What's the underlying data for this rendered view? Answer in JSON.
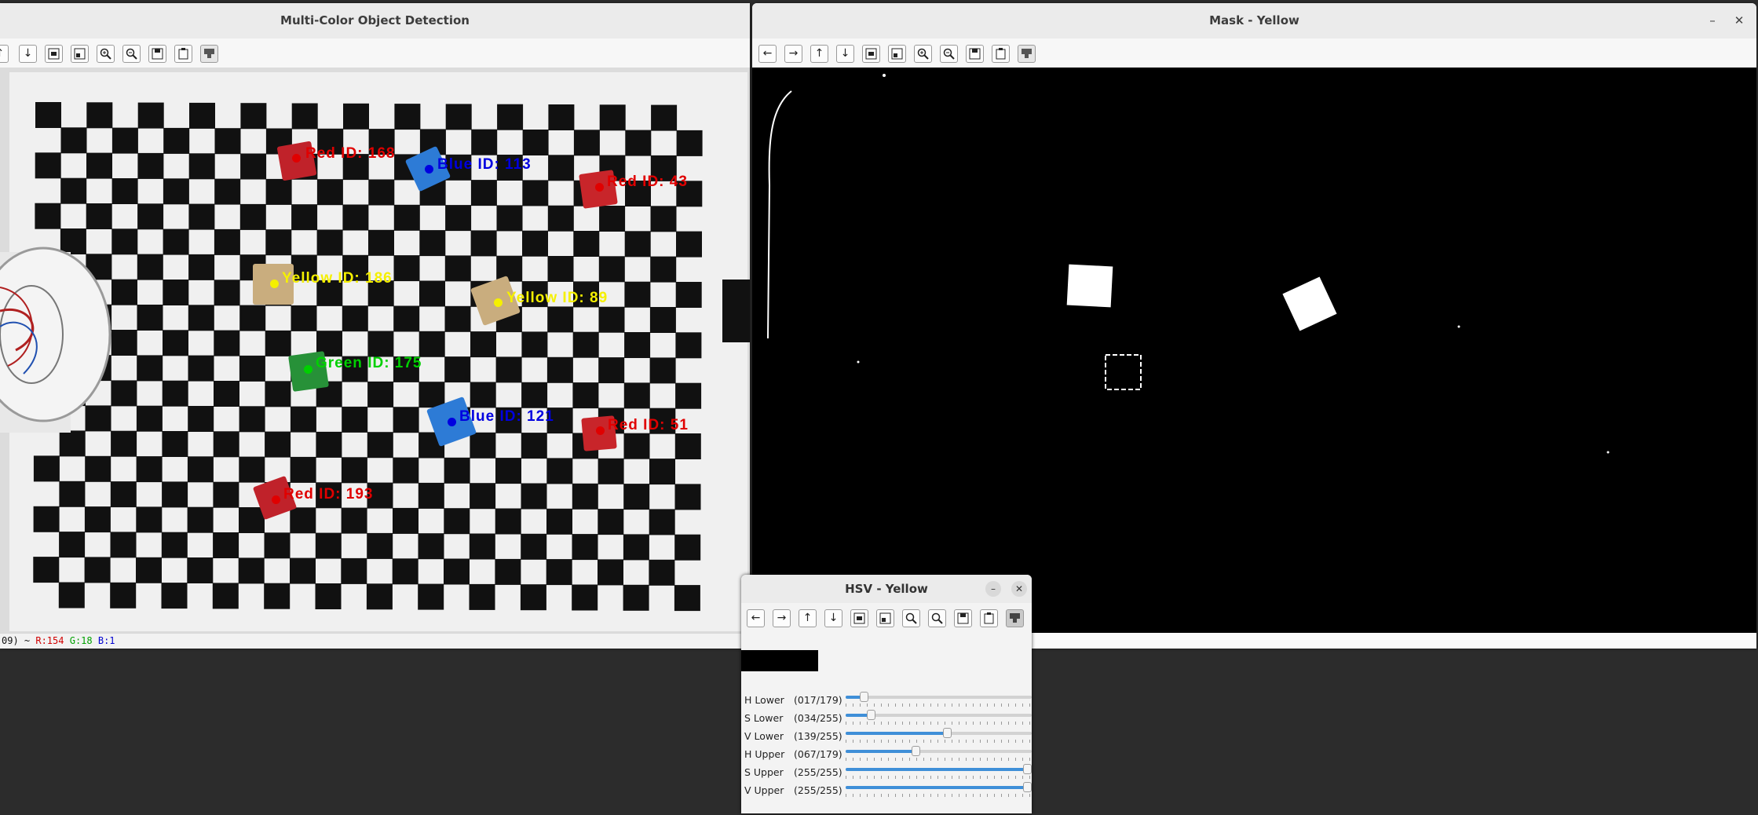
{
  "detection_window": {
    "title": "Multi-Color Object Detection",
    "status": {
      "prefix": "09) ~ ",
      "r": "R:154",
      "g": "G:18",
      "b": "B:1"
    },
    "objects": [
      {
        "label": "Red ID: 168",
        "color": "#e00000"
      },
      {
        "label": "Blue ID: 113",
        "color": "#0000e0"
      },
      {
        "label": "Red ID: 43",
        "color": "#e00000"
      },
      {
        "label": "Yellow ID: 186",
        "color": "#f5f000"
      },
      {
        "label": "Yellow ID: 89",
        "color": "#f5f000"
      },
      {
        "label": "Green ID: 175",
        "color": "#00d000"
      },
      {
        "label": "Blue ID: 121",
        "color": "#0000e0"
      },
      {
        "label": "Red ID: 51",
        "color": "#e00000"
      },
      {
        "label": "Red ID: 193",
        "color": "#e00000"
      }
    ]
  },
  "mask_window": {
    "title": "Mask - Yellow",
    "minimize": "–",
    "close": "✕"
  },
  "hsv_window": {
    "title": "HSV - Yellow",
    "minimize": "–",
    "close": "✕",
    "sliders": [
      {
        "name": "H Lower",
        "value": "(017/179)",
        "fraction": 0.095
      },
      {
        "name": "S Lower",
        "value": "(034/255)",
        "fraction": 0.133
      },
      {
        "name": "V Lower",
        "value": "(139/255)",
        "fraction": 0.545
      },
      {
        "name": "H Upper",
        "value": "(067/179)",
        "fraction": 0.374
      },
      {
        "name": "S Upper",
        "value": "(255/255)",
        "fraction": 1.0
      },
      {
        "name": "V Upper",
        "value": "(255/255)",
        "fraction": 1.0
      }
    ]
  },
  "toolbar_icons": [
    "pan-left-icon",
    "pan-right-icon",
    "pan-up-icon",
    "pan-down-icon",
    "zoom-in-icon",
    "zoom-out-icon",
    "save-icon",
    "copy-icon",
    "properties-icon"
  ]
}
